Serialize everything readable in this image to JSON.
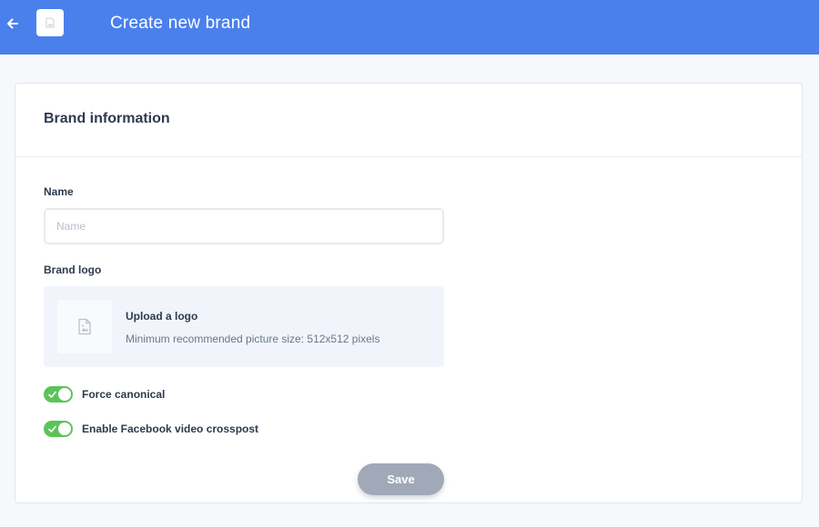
{
  "header": {
    "title": "Create new brand",
    "back_icon": "arrow-left-icon",
    "avatar_icon": "image-placeholder-icon"
  },
  "card": {
    "title": "Brand information"
  },
  "form": {
    "name_label": "Name",
    "name_value": "",
    "name_placeholder": "Name",
    "logo_label": "Brand logo",
    "upload_title": "Upload a logo",
    "upload_hint": "Minimum recommended picture size: 512x512 pixels",
    "toggles": [
      {
        "label": "Force canonical",
        "enabled": true
      },
      {
        "label": "Enable Facebook video crosspost",
        "enabled": true
      }
    ],
    "save_label": "Save"
  },
  "colors": {
    "header_bg": "#4a80ec",
    "toggle_on": "#5cc35a",
    "save_disabled": "#a1a9b8"
  }
}
